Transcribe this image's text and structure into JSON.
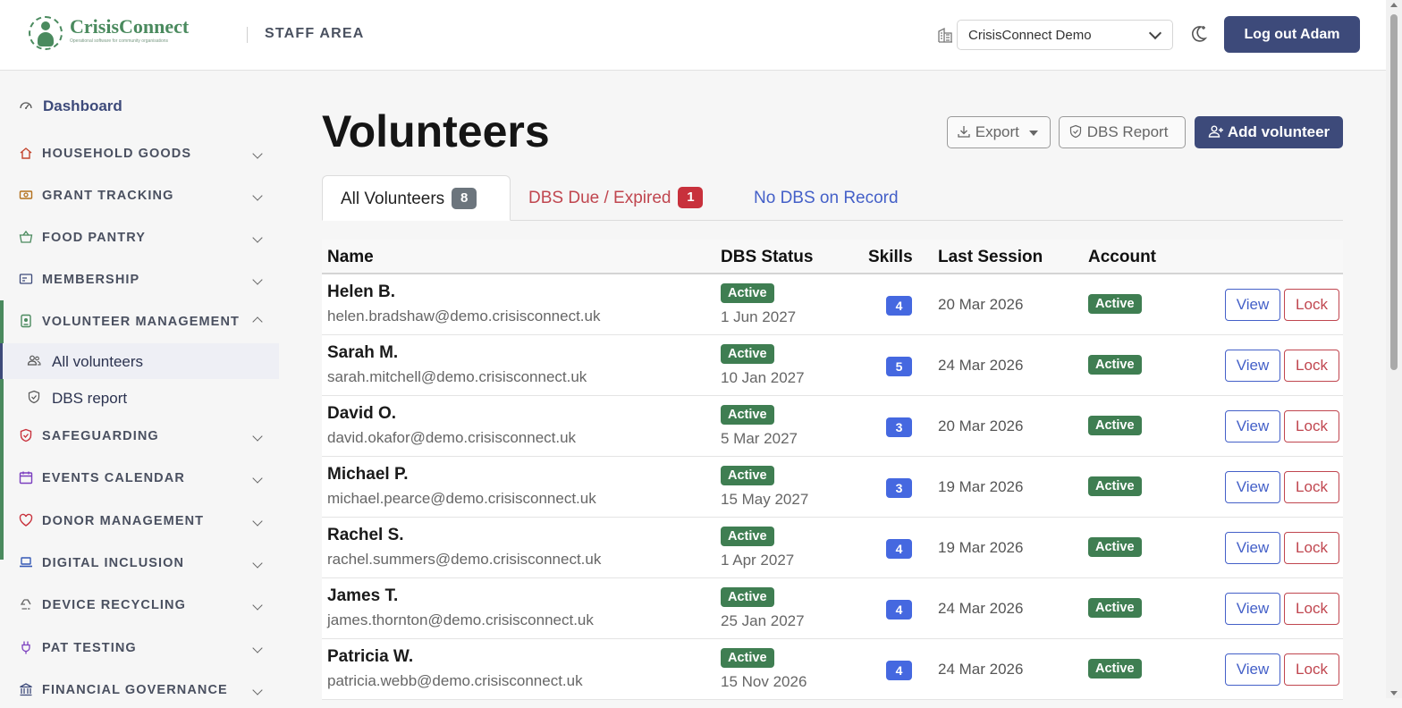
{
  "header": {
    "brand": {
      "name_part1": "Crisis",
      "name_part2": "Connect",
      "tagline": "Operational software for community organisations"
    },
    "section": "STAFF AREA",
    "org_select": {
      "value": "CrisisConnect Demo"
    },
    "logout_label": "Log out Adam"
  },
  "sidebar": {
    "dashboard": "Dashboard",
    "groups": [
      {
        "label": "HOUSEHOLD GOODS",
        "icon": "house-icon"
      },
      {
        "label": "GRANT TRACKING",
        "icon": "cash-icon"
      },
      {
        "label": "FOOD PANTRY",
        "icon": "basket-icon"
      },
      {
        "label": "MEMBERSHIP",
        "icon": "card-icon"
      },
      {
        "label": "VOLUNTEER MANAGEMENT",
        "icon": "badge-icon"
      },
      {
        "label": "SAFEGUARDING",
        "icon": "shield-icon"
      },
      {
        "label": "EVENTS CALENDAR",
        "icon": "calendar-icon"
      },
      {
        "label": "DONOR MANAGEMENT",
        "icon": "heart-icon"
      },
      {
        "label": "DIGITAL INCLUSION",
        "icon": "laptop-icon"
      },
      {
        "label": "DEVICE RECYCLING",
        "icon": "recycle-icon"
      },
      {
        "label": "PAT TESTING",
        "icon": "plug-icon"
      },
      {
        "label": "FINANCIAL GOVERNANCE",
        "icon": "bank-icon"
      }
    ],
    "sub_items": [
      {
        "label": "All volunteers",
        "icon": "people-icon"
      },
      {
        "label": "DBS report",
        "icon": "shield-check-icon"
      }
    ],
    "colors": {
      "accent": "#3d4a7a",
      "active_bar": "#4a8a5e"
    }
  },
  "main": {
    "title": "Volunteers",
    "actions": {
      "export": "Export",
      "dbs_report": "DBS Report",
      "add": "Add volunteer"
    },
    "tabs": [
      {
        "label": "All Volunteers",
        "count": "8"
      },
      {
        "label": "DBS Due / Expired",
        "count": "1"
      },
      {
        "label": "No DBS on Record"
      }
    ],
    "columns": {
      "name": "Name",
      "dbs": "DBS Status",
      "skills": "Skills",
      "last": "Last Session",
      "account": "Account"
    },
    "rows": [
      {
        "name": "Helen B.",
        "email": "helen.bradshaw@demo.crisisconnect.uk",
        "dbs_status": "Active",
        "dbs_date": "1 Jun 2027",
        "skills": "4",
        "last": "20 Mar 2026",
        "account": "Active",
        "view": "View",
        "lock": "Lock"
      },
      {
        "name": "Sarah M.",
        "email": "sarah.mitchell@demo.crisisconnect.uk",
        "dbs_status": "Active",
        "dbs_date": "10 Jan 2027",
        "skills": "5",
        "last": "24 Mar 2026",
        "account": "Active",
        "view": "View",
        "lock": "Lock"
      },
      {
        "name": "David O.",
        "email": "david.okafor@demo.crisisconnect.uk",
        "dbs_status": "Active",
        "dbs_date": "5 Mar 2027",
        "skills": "3",
        "last": "20 Mar 2026",
        "account": "Active",
        "view": "View",
        "lock": "Lock"
      },
      {
        "name": "Michael P.",
        "email": "michael.pearce@demo.crisisconnect.uk",
        "dbs_status": "Active",
        "dbs_date": "15 May 2027",
        "skills": "3",
        "last": "19 Mar 2026",
        "account": "Active",
        "view": "View",
        "lock": "Lock"
      },
      {
        "name": "Rachel S.",
        "email": "rachel.summers@demo.crisisconnect.uk",
        "dbs_status": "Active",
        "dbs_date": "1 Apr 2027",
        "skills": "4",
        "last": "19 Mar 2026",
        "account": "Active",
        "view": "View",
        "lock": "Lock"
      },
      {
        "name": "James T.",
        "email": "james.thornton@demo.crisisconnect.uk",
        "dbs_status": "Active",
        "dbs_date": "25 Jan 2027",
        "skills": "4",
        "last": "24 Mar 2026",
        "account": "Active",
        "view": "View",
        "lock": "Lock"
      },
      {
        "name": "Patricia W.",
        "email": "patricia.webb@demo.crisisconnect.uk",
        "dbs_status": "Active",
        "dbs_date": "15 Nov 2026",
        "skills": "4",
        "last": "24 Mar 2026",
        "account": "Active",
        "view": "View",
        "lock": "Lock"
      }
    ]
  }
}
